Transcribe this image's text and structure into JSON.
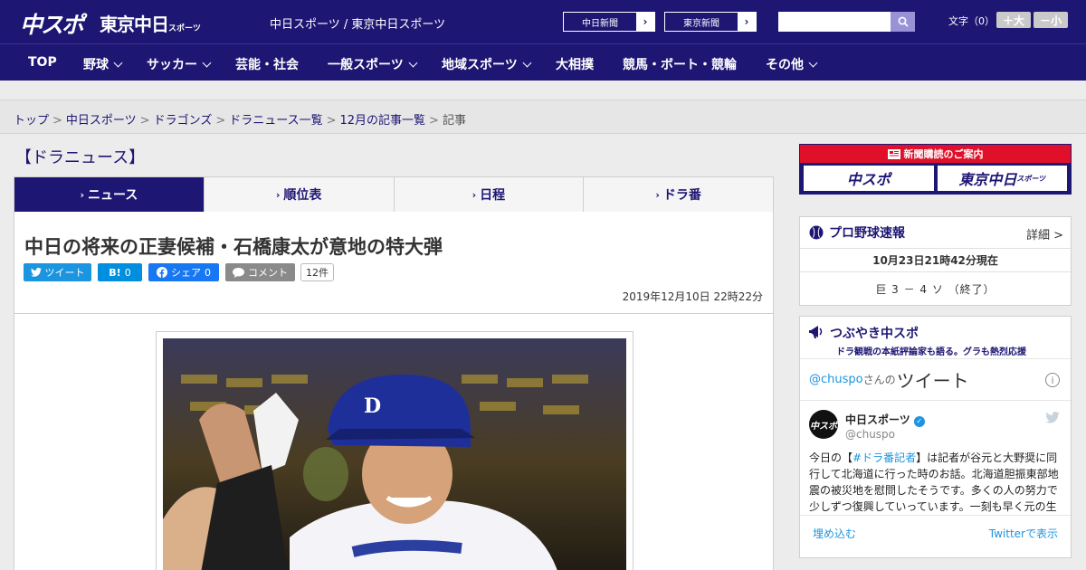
{
  "header": {
    "logo_main": "中スポ",
    "logo_tokyo": "東京中日",
    "logo_tokyo_small": "スポーツ",
    "site_title": "中日スポーツ / 東京中日スポーツ",
    "ext_links": [
      {
        "label": "中日新聞"
      },
      {
        "label": "東京新聞"
      }
    ],
    "search_placeholder": "",
    "font_label": "文字（0）",
    "font_larger": "＋大",
    "font_smaller": "－小"
  },
  "nav": {
    "items": [
      {
        "label": "TOP",
        "dropdown": false
      },
      {
        "label": "野球",
        "dropdown": true
      },
      {
        "label": "サッカー",
        "dropdown": true
      },
      {
        "label": "芸能・社会",
        "dropdown": false
      },
      {
        "label": "一般スポーツ",
        "dropdown": true
      },
      {
        "label": "地域スポーツ",
        "dropdown": true
      },
      {
        "label": "大相撲",
        "dropdown": false
      },
      {
        "label": "競馬・ボート・競輪",
        "dropdown": false
      },
      {
        "label": "その他",
        "dropdown": true
      }
    ]
  },
  "breadcrumb": {
    "links": [
      "トップ",
      "中日スポーツ",
      "ドラゴンズ",
      "ドラニュース一覧",
      "12月の記事一覧"
    ],
    "current": "記事",
    "separator": ">"
  },
  "main": {
    "section_title": "【ドラニュース】",
    "tabs": [
      {
        "label": "ニュース",
        "active": true
      },
      {
        "label": "順位表",
        "active": false
      },
      {
        "label": "日程",
        "active": false
      },
      {
        "label": "ドラ番",
        "active": false
      }
    ],
    "headline": "中日の将来の正妻候補・石橋康太が意地の特大弾",
    "share": {
      "tweet": "ツイート",
      "hatena_icon": "B!",
      "hatena_count": "0",
      "facebook": "シェア",
      "facebook_count": "0",
      "comment": "コメント",
      "comment_count": "12件"
    },
    "date": "2019年12月10日 22時22分"
  },
  "sidebar": {
    "promo_title": "新聞購読のご案内",
    "promo_logo_1": "中スポ",
    "promo_logo_2": "東京中日",
    "promo_logo_2_small": "スポーツ",
    "score": {
      "title": "プロ野球速報",
      "detail": "詳細 >",
      "time": "10月23日21時42分現在",
      "line": "巨 3 － 4 ソ （終了）"
    },
    "twitter": {
      "title": "つぶやき中スポ",
      "subtitle": "ドラ観戦の本紙評論家も語る。グラも熱烈応援",
      "handle": "@chuspo",
      "handle_suffix": "さんの",
      "word": "ツイート",
      "tweet": {
        "name": "中日スポーツ",
        "user": "@chuspo",
        "avatar_text": "中スポ",
        "text_before": "今日の【",
        "hashtag": "#ドラ番記者",
        "text_after": "】は記者が谷元と大野奨に同行して北海道に行った時のお話。北海道胆振東部地震の被災地を慰問したそうです。多くの人の努力で少しずつ復興していっています。一刻も早く元の生"
      },
      "embed": "埋め込む",
      "view_on": "Twitterで表示"
    }
  },
  "colors": {
    "brand": "#1e1673",
    "twitter": "#1b95e0",
    "hatena": "#008fde",
    "facebook": "#1877f2",
    "promo_red": "#e0102a"
  }
}
